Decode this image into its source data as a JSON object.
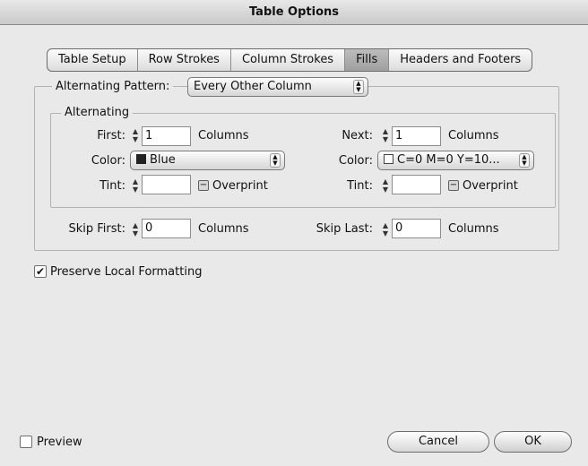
{
  "window": {
    "title": "Table Options"
  },
  "tabs": [
    {
      "label": "Table Setup"
    },
    {
      "label": "Row Strokes"
    },
    {
      "label": "Column Strokes"
    },
    {
      "label": "Fills"
    },
    {
      "label": "Headers and Footers"
    }
  ],
  "active_tab": "Fills",
  "alternating_pattern": {
    "label": "Alternating Pattern:",
    "value": "Every Other Column"
  },
  "alternating": {
    "legend": "Alternating",
    "first": {
      "label": "First:",
      "value": "1",
      "unit": "Columns"
    },
    "next": {
      "label": "Next:",
      "value": "1",
      "unit": "Columns"
    },
    "color_left": {
      "label": "Color:",
      "value": "Blue"
    },
    "color_right": {
      "label": "Color:",
      "value": "C=0 M=0 Y=10..."
    },
    "tint_left": {
      "label": "Tint:",
      "value": ""
    },
    "tint_right": {
      "label": "Tint:",
      "value": ""
    },
    "overprint_left": "Overprint",
    "overprint_right": "Overprint"
  },
  "skip_first": {
    "label": "Skip First:",
    "value": "0",
    "unit": "Columns"
  },
  "skip_last": {
    "label": "Skip Last:",
    "value": "0",
    "unit": "Columns"
  },
  "preserve": {
    "label": "Preserve Local Formatting",
    "checked": true
  },
  "footer": {
    "preview_label": "Preview",
    "preview_checked": false,
    "cancel_label": "Cancel",
    "ok_label": "OK"
  }
}
